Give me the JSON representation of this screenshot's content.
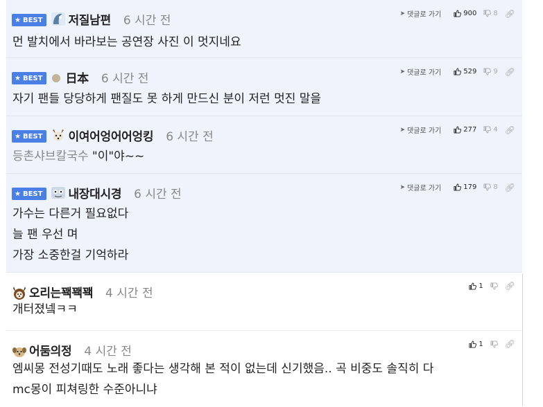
{
  "badge_label": "BEST",
  "reply_label": "댓글로 가기",
  "comments": [
    {
      "nick": "저질남편",
      "time": "6 시간 전",
      "up": "900",
      "down": "8",
      "lines": [
        "먼 발치에서 바라보는 공연장 사진 이 멋지네요"
      ]
    },
    {
      "nick": "日本",
      "time": "6 시간 전",
      "up": "529",
      "down": "9",
      "lines": [
        "자기 팬들 당당하게 팬질도 못 하게 만드신 분이 저런 멋진 말을"
      ]
    },
    {
      "nick": "이여어엉어어엉킹",
      "time": "6 시간 전",
      "up": "277",
      "down": "4",
      "ref": "등촌샤브칼국수",
      "lines": [
        "\"이\"야~~"
      ]
    },
    {
      "nick": "내장대시경",
      "time": "6 시간 전",
      "up": "179",
      "down": "8",
      "lines": [
        "가수는 다른거 필요없다",
        "늘 팬 우선 며",
        "가장 소중한걸 기억하라"
      ]
    },
    {
      "nick": "오리는꽥꽥꽥",
      "time": "4 시간 전",
      "up": "1",
      "lines": [
        "개터졌넼ㅋㅋ"
      ]
    },
    {
      "nick": "어둠의정",
      "time": "4 시간 전",
      "up": "1",
      "lines": [
        "엠씨몽 전성기때도 노래 좋다는 생각해 본 적이 없는데 신기했음.. 곡 비중도 솔직히 다",
        "mc몽이 피쳐링한 수준아니냐"
      ]
    }
  ]
}
